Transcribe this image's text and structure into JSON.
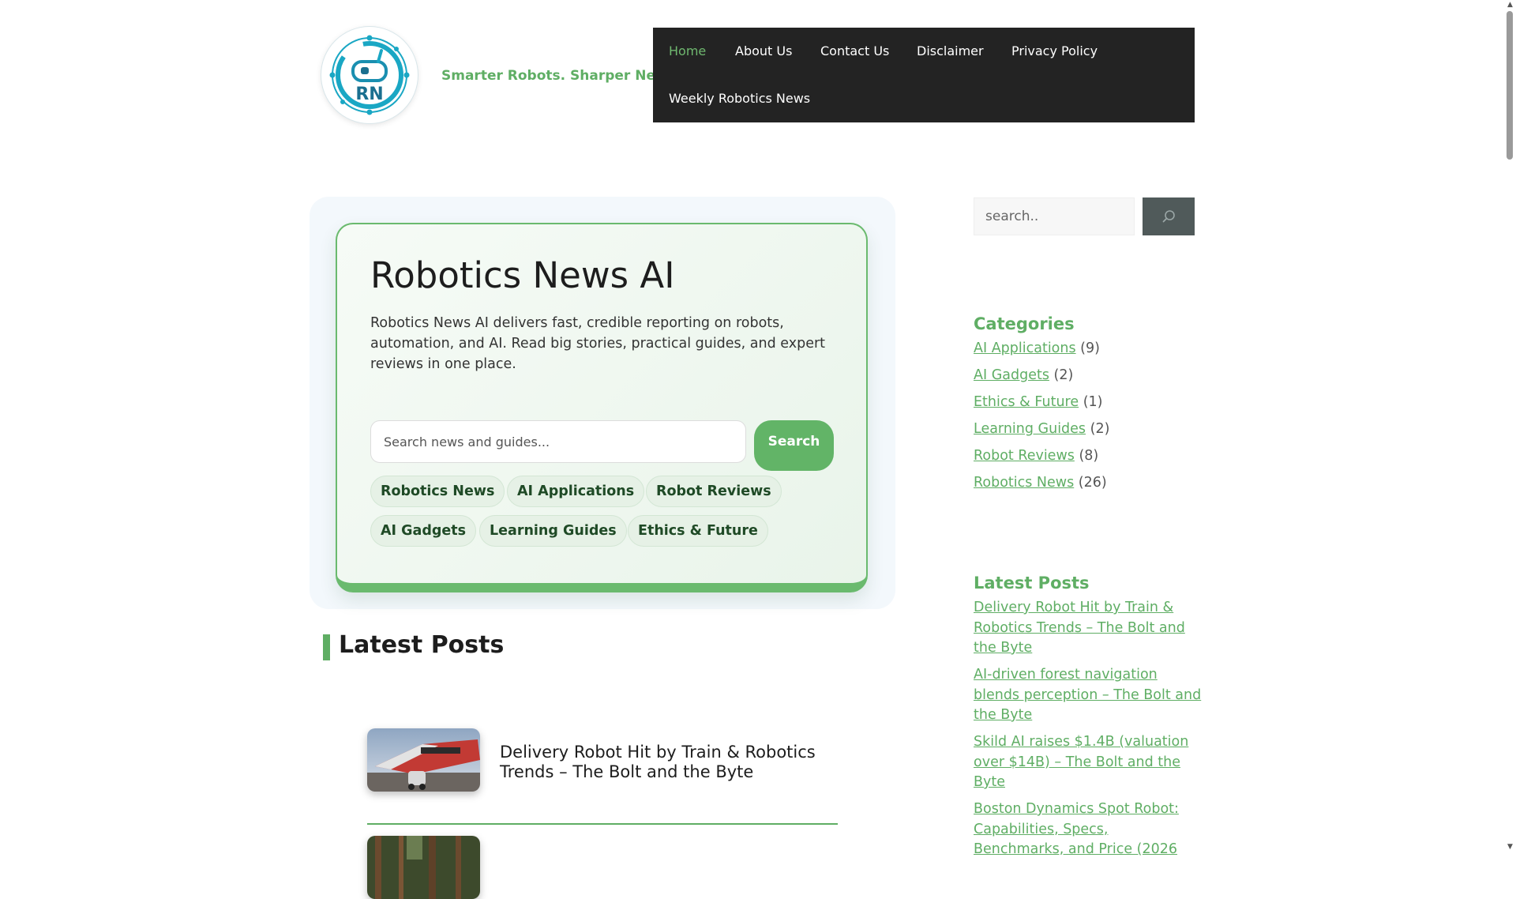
{
  "header": {
    "logo_text": "RN",
    "tagline": "Smarter Robots. Sharper News."
  },
  "nav": {
    "items": [
      {
        "label": "Home",
        "active": true
      },
      {
        "label": "About Us"
      },
      {
        "label": "Contact Us"
      },
      {
        "label": "Disclaimer"
      },
      {
        "label": "Privacy Policy"
      },
      {
        "label": "Weekly Robotics News"
      }
    ]
  },
  "hero": {
    "title": "Robotics News AI",
    "description": "Robotics News AI delivers fast, credible reporting on robots, automation, and AI. Read big stories, practical guides, and expert reviews in one place.",
    "search_placeholder": "Search news and guides...",
    "search_button": "Search",
    "chips": [
      "Robotics News",
      "AI Applications",
      "Robot Reviews",
      "AI Gadgets",
      "Learning Guides",
      "Ethics & Future"
    ]
  },
  "main": {
    "latest_heading": "Latest Posts",
    "posts": [
      {
        "title": "Delivery Robot Hit by Train & Robotics Trends – The Bolt and the Byte"
      }
    ]
  },
  "sidebar": {
    "search_placeholder": "search..",
    "search_icon": "search-icon",
    "categories_heading": "Categories",
    "categories": [
      {
        "name": "AI Applications",
        "count": "(9)"
      },
      {
        "name": "AI Gadgets",
        "count": "(2)"
      },
      {
        "name": "Ethics & Future",
        "count": "(1)"
      },
      {
        "name": "Learning Guides",
        "count": "(2)"
      },
      {
        "name": "Robot Reviews",
        "count": "(8)"
      },
      {
        "name": "Robotics News",
        "count": "(26)"
      }
    ],
    "latest_heading": "Latest Posts",
    "latest_posts": [
      "Delivery Robot Hit by Train & Robotics Trends – The Bolt and the Byte",
      "AI-driven forest navigation blends perception – The Bolt and the Byte",
      "Skild AI raises $1.4B (valuation over $14B) – The Bolt and the Byte",
      "Boston Dynamics Spot Robot: Capabilities, Specs, Benchmarks, and Price (2026"
    ]
  },
  "colors": {
    "brand_green": "#5fae64",
    "nav_background": "#232323",
    "nav_active": "#6fb86f"
  }
}
